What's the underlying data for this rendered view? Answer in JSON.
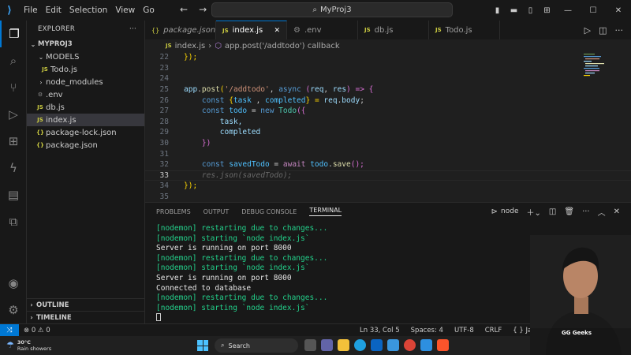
{
  "titlebar": {
    "menu": [
      "File",
      "Edit",
      "Selection",
      "View",
      "Go"
    ],
    "search_text": "MyProj3"
  },
  "sidebar": {
    "title": "EXPLORER",
    "project": "MYPROJ3",
    "models_folder": "MODELS",
    "todo_model": "Todo.js",
    "node_modules": "node_modules",
    "env": ".env",
    "db": "db.js",
    "index": "index.js",
    "package_lock": "package-lock.json",
    "package": "package.json",
    "outline": "OUTLINE",
    "timeline": "TIMELINE",
    "js_badge": "JS",
    "json_badge": "{}"
  },
  "tabs": [
    "package.json",
    "index.js",
    ".env",
    "db.js",
    "Todo.js"
  ],
  "breadcrumb": {
    "file": "index.js",
    "symbol": "app.post('/addtodo') callback"
  },
  "editor": {
    "line_numbers": [
      "22",
      "23",
      "24",
      "25",
      "26",
      "27",
      "28",
      "29",
      "30",
      "31",
      "32",
      "33",
      "34",
      "35"
    ],
    "l22": "});",
    "l25a": "app",
    "l25b": ".",
    "l25c": "post",
    "l25d": "(",
    "l25e": "'/addtodo'",
    "l25f": ", ",
    "l25g": "async",
    "l25h": " (",
    "l25i": "req",
    "l25j": ", ",
    "l25k": "res",
    "l25l": ") => {",
    "l26a": "const",
    "l26b": " {",
    "l26c": "task",
    "l26d": " , ",
    "l26e": "completed",
    "l26f": "} = ",
    "l26g": "req",
    "l26h": ".",
    "l26i": "body",
    "l26j": ";",
    "l27a": "const",
    "l27b": " todo",
    "l27c": " = ",
    "l27d": "new",
    "l27e": " Todo",
    "l27f": "({",
    "l28": "task,",
    "l29": "completed",
    "l30": "})",
    "l32a": "const",
    "l32b": " savedTodo",
    "l32c": " = ",
    "l32d": "await",
    "l32e": " todo",
    "l32f": ".",
    "l32g": "save",
    "l32h": "();",
    "l33": "res.json(savedTodo);",
    "l34": "});"
  },
  "panel": {
    "tabs": [
      "PROBLEMS",
      "OUTPUT",
      "DEBUG CONSOLE",
      "TERMINAL"
    ],
    "shell": "node",
    "terminal_lines": [
      "[nodemon] restarting due to changes...",
      "[nodemon] starting `node index.js`",
      "Server is running on port 8000",
      "[nodemon] restarting due to changes...",
      "[nodemon] starting `node index.js`",
      "Server is running on port 8000",
      "Connected to database",
      "[nodemon] restarting due to changes...",
      "[nodemon] starting `node index.js`"
    ]
  },
  "statusbar": {
    "problems": "⊗ 0 ⚠ 0",
    "position": "Ln 33, Col 5",
    "spaces": "Spaces: 4",
    "encoding": "UTF-8",
    "eol": "CRLF",
    "language": "{ } JavaScript"
  },
  "taskbar": {
    "temp": "30°C",
    "weather": "Rain showers",
    "search": "Search"
  },
  "watermark": "GG Geeks",
  "colors": {
    "accent": "#0078d4",
    "terminal_green": "#23d18b"
  }
}
